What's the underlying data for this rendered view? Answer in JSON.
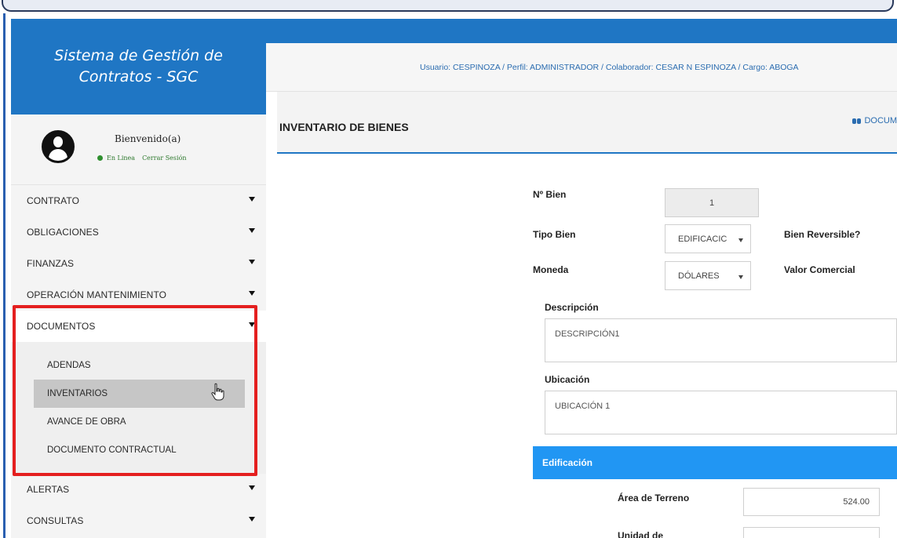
{
  "app": {
    "title": "Sistema de Gestión de Contratos - SGC"
  },
  "user_panel": {
    "welcome": "Bienvenido(a)",
    "status": "En Linea",
    "logout": "Cerrar Sesión"
  },
  "sidebar": {
    "items": [
      {
        "label": "CONTRATO"
      },
      {
        "label": "OBLIGACIONES"
      },
      {
        "label": "FINANZAS"
      },
      {
        "label": "OPERACIÓN MANTENIMIENTO"
      },
      {
        "label": "DOCUMENTOS"
      },
      {
        "label": "ALERTAS"
      },
      {
        "label": "CONSULTAS"
      }
    ],
    "documentos_submenu": [
      {
        "label": "ADENDAS"
      },
      {
        "label": "INVENTARIOS"
      },
      {
        "label": "AVANCE DE OBRA"
      },
      {
        "label": "DOCUMENTO CONTRACTUAL"
      }
    ]
  },
  "header": {
    "user_info": "Usuario: CESPINOZA / Perfil: ADMINISTRADOR / Colaborador: CESAR N ESPINOZA / Cargo: ABOGA",
    "page_title": "INVENTARIO DE BIENES",
    "doc_link": "DOCUM"
  },
  "form": {
    "n_bien_label": "Nº Bien",
    "n_bien_value": "1",
    "tipo_bien_label": "Tipo Bien",
    "tipo_bien_value": "EDIFICACIC",
    "bien_reversible_label": "Bien Reversible?",
    "moneda_label": "Moneda",
    "moneda_value": "DÓLARES",
    "valor_comercial_label": "Valor Comercial",
    "descripcion_label": "Descripción",
    "descripcion_value": "DESCRIPCIÓN1",
    "ubicacion_label": "Ubicación",
    "ubicacion_value": "UBICACIÓN 1",
    "section_title": "Edificación",
    "area_terreno_label": "Área de Terreno",
    "area_terreno_value": "524.00",
    "unidad_label": "Unidad de"
  },
  "colors": {
    "brand_blue": "#1f76c4",
    "section_blue": "#2196f3",
    "highlight_red": "#e41f1f"
  }
}
